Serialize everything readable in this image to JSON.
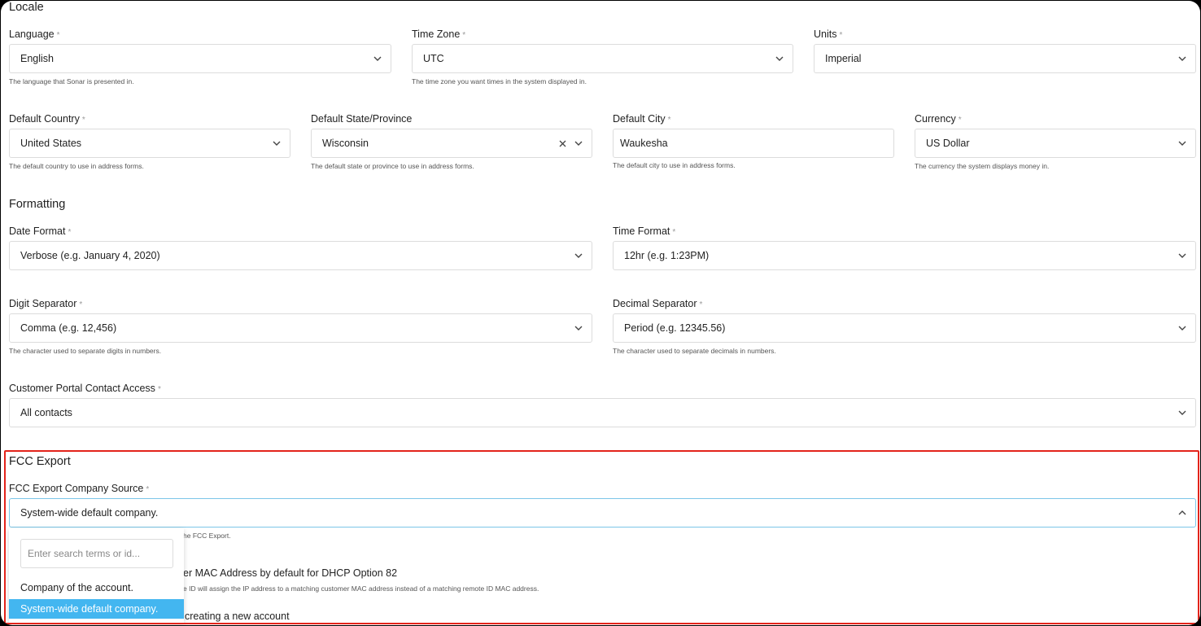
{
  "locale": {
    "title": "Locale",
    "language": {
      "label": "Language",
      "value": "English",
      "help": "The language that Sonar is presented in."
    },
    "time_zone": {
      "label": "Time Zone",
      "value": "UTC",
      "help": "The time zone you want times in the system displayed in."
    },
    "units": {
      "label": "Units",
      "value": "Imperial"
    },
    "default_country": {
      "label": "Default Country",
      "value": "United States",
      "help": "The default country to use in address forms."
    },
    "default_state": {
      "label": "Default State/Province",
      "value": "Wisconsin",
      "help": "The default state or province to use in address forms."
    },
    "default_city": {
      "label": "Default City",
      "value": "Waukesha",
      "help": "The default city to use in address forms."
    },
    "currency": {
      "label": "Currency",
      "value": "US Dollar",
      "help": "The currency the system displays money in."
    }
  },
  "formatting": {
    "title": "Formatting",
    "date_format": {
      "label": "Date Format",
      "value": "Verbose (e.g. January 4, 2020)"
    },
    "time_format": {
      "label": "Time Format",
      "value": "12hr (e.g. 1:23PM)"
    },
    "digit_separator": {
      "label": "Digit Separator",
      "value": "Comma (e.g. 12,456)",
      "help": "The character used to separate digits in numbers."
    },
    "decimal_separator": {
      "label": "Decimal Separator",
      "value": "Period (e.g. 12345.56)",
      "help": "The character used to separate decimals in numbers."
    },
    "portal_access": {
      "label": "Customer Portal Contact Access",
      "value": "All contacts"
    }
  },
  "fcc": {
    "title": "FCC Export",
    "company_source": {
      "label": "FCC Export Company Source",
      "value": "System-wide default company.",
      "help_fragment": "he FCC Export."
    },
    "dropdown": {
      "search_placeholder": "Enter search terms or id...",
      "options": [
        "Company of the account.",
        "System-wide default company."
      ]
    },
    "dhcp_label_fragment": "er MAC Address by default for DHCP Option 82",
    "dhcp_help_fragment": "e ID will assign the IP address to a matching customer MAC address instead of a matching remote ID MAC address.",
    "radius_label_fragment": "creating a new account"
  },
  "required_marker": "*",
  "colors": {
    "highlight": "#e3241b",
    "selected": "#43b6f0",
    "focus": "#7cc6e8"
  },
  "icons": {
    "chevron": "chevron-down-icon",
    "chevron_up": "chevron-up-icon",
    "clear": "close-icon"
  }
}
